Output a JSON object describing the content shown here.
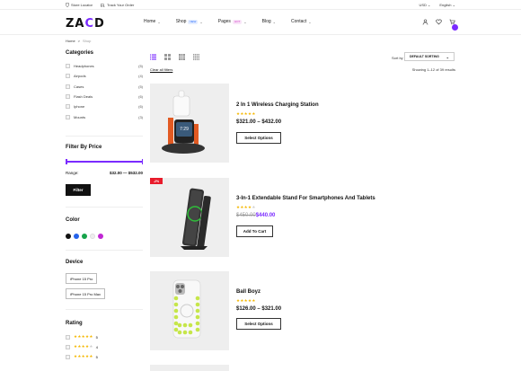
{
  "topbar": {
    "store_locator": "Store Locator",
    "track_order": "Track Your Order",
    "currency": "USD",
    "language": "English"
  },
  "header": {
    "logo_text_a": "ZA",
    "logo_text_b": "C",
    "logo_text_c": "D",
    "nav": [
      {
        "label": "Home"
      },
      {
        "label": "Shop",
        "badge": "NEW",
        "badge_color": "#2b6fff"
      },
      {
        "label": "Pages",
        "badge": "HOT",
        "badge_color": "#d13cc7"
      },
      {
        "label": "Blog"
      },
      {
        "label": "Contact"
      }
    ],
    "icons": [
      "user-icon",
      "heart-icon",
      "cart-icon"
    ]
  },
  "breadcrumb": {
    "home": "Home",
    "sep": ">",
    "current": "Shop"
  },
  "sidebar": {
    "categories_title": "Categories",
    "categories": [
      {
        "label": "Headphones",
        "count": "(5)"
      },
      {
        "label": "Airpods",
        "count": "(4)"
      },
      {
        "label": "Cases",
        "count": "(5)"
      },
      {
        "label": "Flash Deals",
        "count": "(6)"
      },
      {
        "label": "Iphone",
        "count": "(6)"
      },
      {
        "label": "Mounts",
        "count": "(3)"
      }
    ],
    "price_title": "Filter By Price",
    "range_label": "Range:",
    "range_value": "$32.00 — $532.00",
    "filter_button": "Filter",
    "color_title": "Color",
    "colors": [
      "#111111",
      "#2563eb",
      "#16a34a",
      "#eeeeee",
      "#c026d3"
    ],
    "device_title": "Device",
    "devices": [
      "iPhone 15 Pro",
      "iPhone 15 Pro Max"
    ],
    "rating_title": "Rating",
    "ratings": [
      {
        "stars": 5,
        "label": "5"
      },
      {
        "stars": 4,
        "label": "4"
      },
      {
        "stars": 5,
        "label": "5"
      }
    ]
  },
  "toolbar": {
    "sort_label": "Sort by",
    "sort_value": "DEFAULT SORTING",
    "clear_all": "Clear all filters",
    "showing": "Showing 1–12 of 39 results"
  },
  "products": [
    {
      "name": "2 In 1 Wireless Charging Station",
      "stars": 5,
      "price": "$321.00 – $432.00",
      "button": "Select Options"
    },
    {
      "name": "3-In-1 Extendable Stand For Smartphones And Tablets",
      "stars": 4,
      "sale_badge": "-2%",
      "old_price": "$450.00",
      "new_price": "$440.00",
      "button": "Add To Cart"
    },
    {
      "name": "Ball Boyz",
      "stars": 5,
      "price": "$126.00 – $321.00",
      "button": "Select Options"
    }
  ]
}
